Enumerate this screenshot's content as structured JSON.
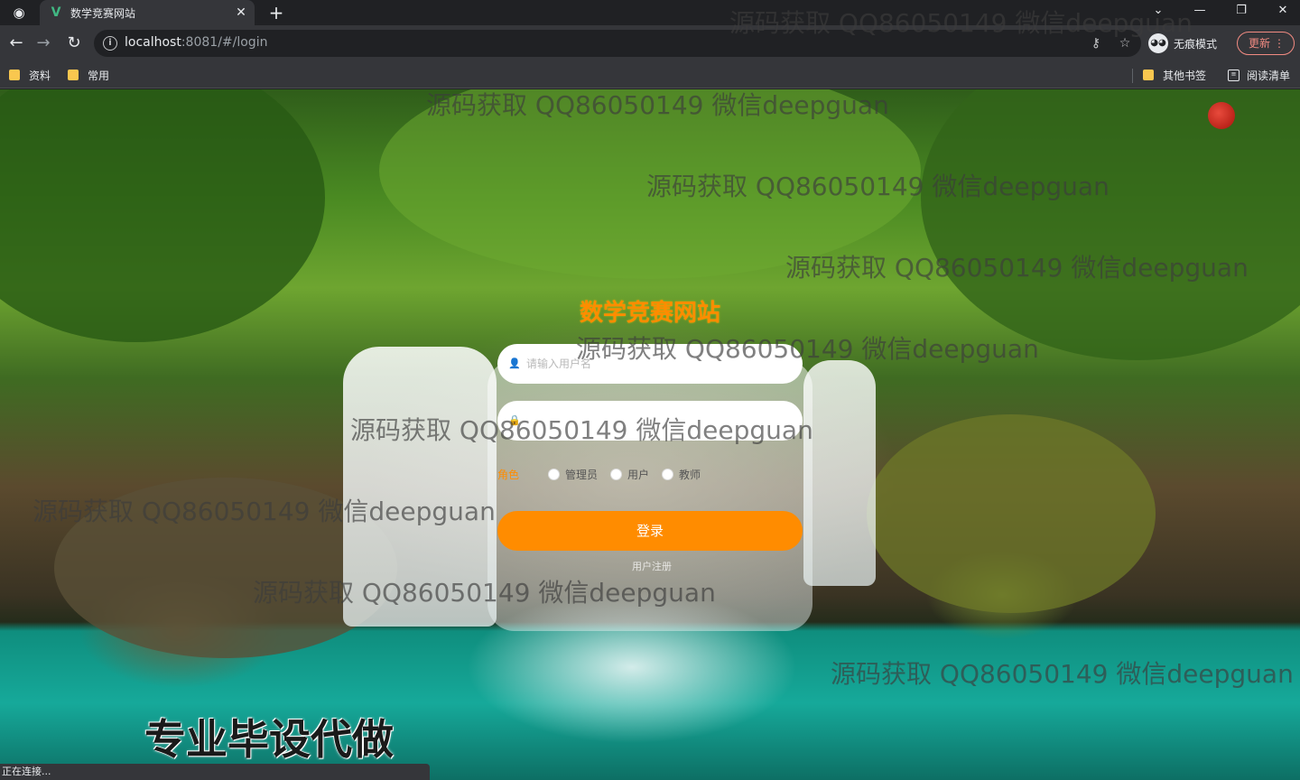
{
  "browser": {
    "tab": {
      "title": "数学竞赛网站",
      "favicon": "V"
    },
    "url": {
      "host": "localhost",
      "rest": ":8081/#/login"
    },
    "incognito_label": "无痕模式",
    "update_label": "更新",
    "bookmarks": [
      {
        "label": "资料"
      },
      {
        "label": "常用"
      }
    ],
    "bookmarks_right": [
      {
        "label": "其他书签"
      },
      {
        "label": "阅读清单"
      }
    ],
    "status_text": "正在连接..."
  },
  "page": {
    "site_title": "数学竞赛网站",
    "username_placeholder": "请输入用户名",
    "password_placeholder": "",
    "role_label": "角色",
    "roles": [
      {
        "label": "管理员"
      },
      {
        "label": "用户"
      },
      {
        "label": "教师"
      }
    ],
    "login_label": "登录",
    "register_label": "用户注册",
    "promo_text": "专业毕设代做"
  },
  "watermarks": [
    "源码获取 QQ86050149 微信deepguan",
    "源码获取 QQ86050149 微信deepguan",
    "源码获取 QQ86050149 微信deepguan",
    "源码获取 QQ86050149 微信deepguan",
    "源码获取 QQ86050149 微信deepguan",
    "源码获取 QQ86050149 微信deepguan",
    "源码获取 QQ86050149 微信deepguan",
    "源码获取 QQ86050149 微信deepguan",
    "源码获取 QQ86050149 微信deepguan"
  ],
  "colors": {
    "accent": "#ff8c00",
    "browser_dark": "#202124",
    "browser_toolbar": "#35363a"
  }
}
